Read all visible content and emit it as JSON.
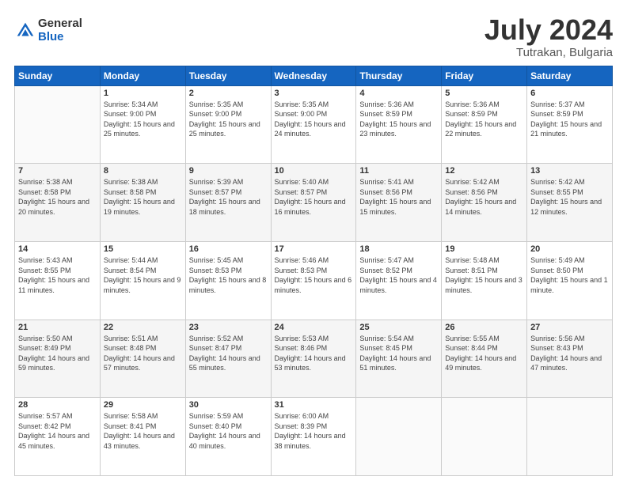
{
  "logo": {
    "general": "General",
    "blue": "Blue"
  },
  "header": {
    "month_year": "July 2024",
    "location": "Tutrakan, Bulgaria"
  },
  "weekdays": [
    "Sunday",
    "Monday",
    "Tuesday",
    "Wednesday",
    "Thursday",
    "Friday",
    "Saturday"
  ],
  "weeks": [
    [
      {
        "day": "",
        "sunrise": "",
        "sunset": "",
        "daylight": ""
      },
      {
        "day": "1",
        "sunrise": "Sunrise: 5:34 AM",
        "sunset": "Sunset: 9:00 PM",
        "daylight": "Daylight: 15 hours and 25 minutes."
      },
      {
        "day": "2",
        "sunrise": "Sunrise: 5:35 AM",
        "sunset": "Sunset: 9:00 PM",
        "daylight": "Daylight: 15 hours and 25 minutes."
      },
      {
        "day": "3",
        "sunrise": "Sunrise: 5:35 AM",
        "sunset": "Sunset: 9:00 PM",
        "daylight": "Daylight: 15 hours and 24 minutes."
      },
      {
        "day": "4",
        "sunrise": "Sunrise: 5:36 AM",
        "sunset": "Sunset: 8:59 PM",
        "daylight": "Daylight: 15 hours and 23 minutes."
      },
      {
        "day": "5",
        "sunrise": "Sunrise: 5:36 AM",
        "sunset": "Sunset: 8:59 PM",
        "daylight": "Daylight: 15 hours and 22 minutes."
      },
      {
        "day": "6",
        "sunrise": "Sunrise: 5:37 AM",
        "sunset": "Sunset: 8:59 PM",
        "daylight": "Daylight: 15 hours and 21 minutes."
      }
    ],
    [
      {
        "day": "7",
        "sunrise": "Sunrise: 5:38 AM",
        "sunset": "Sunset: 8:58 PM",
        "daylight": "Daylight: 15 hours and 20 minutes."
      },
      {
        "day": "8",
        "sunrise": "Sunrise: 5:38 AM",
        "sunset": "Sunset: 8:58 PM",
        "daylight": "Daylight: 15 hours and 19 minutes."
      },
      {
        "day": "9",
        "sunrise": "Sunrise: 5:39 AM",
        "sunset": "Sunset: 8:57 PM",
        "daylight": "Daylight: 15 hours and 18 minutes."
      },
      {
        "day": "10",
        "sunrise": "Sunrise: 5:40 AM",
        "sunset": "Sunset: 8:57 PM",
        "daylight": "Daylight: 15 hours and 16 minutes."
      },
      {
        "day": "11",
        "sunrise": "Sunrise: 5:41 AM",
        "sunset": "Sunset: 8:56 PM",
        "daylight": "Daylight: 15 hours and 15 minutes."
      },
      {
        "day": "12",
        "sunrise": "Sunrise: 5:42 AM",
        "sunset": "Sunset: 8:56 PM",
        "daylight": "Daylight: 15 hours and 14 minutes."
      },
      {
        "day": "13",
        "sunrise": "Sunrise: 5:42 AM",
        "sunset": "Sunset: 8:55 PM",
        "daylight": "Daylight: 15 hours and 12 minutes."
      }
    ],
    [
      {
        "day": "14",
        "sunrise": "Sunrise: 5:43 AM",
        "sunset": "Sunset: 8:55 PM",
        "daylight": "Daylight: 15 hours and 11 minutes."
      },
      {
        "day": "15",
        "sunrise": "Sunrise: 5:44 AM",
        "sunset": "Sunset: 8:54 PM",
        "daylight": "Daylight: 15 hours and 9 minutes."
      },
      {
        "day": "16",
        "sunrise": "Sunrise: 5:45 AM",
        "sunset": "Sunset: 8:53 PM",
        "daylight": "Daylight: 15 hours and 8 minutes."
      },
      {
        "day": "17",
        "sunrise": "Sunrise: 5:46 AM",
        "sunset": "Sunset: 8:53 PM",
        "daylight": "Daylight: 15 hours and 6 minutes."
      },
      {
        "day": "18",
        "sunrise": "Sunrise: 5:47 AM",
        "sunset": "Sunset: 8:52 PM",
        "daylight": "Daylight: 15 hours and 4 minutes."
      },
      {
        "day": "19",
        "sunrise": "Sunrise: 5:48 AM",
        "sunset": "Sunset: 8:51 PM",
        "daylight": "Daylight: 15 hours and 3 minutes."
      },
      {
        "day": "20",
        "sunrise": "Sunrise: 5:49 AM",
        "sunset": "Sunset: 8:50 PM",
        "daylight": "Daylight: 15 hours and 1 minute."
      }
    ],
    [
      {
        "day": "21",
        "sunrise": "Sunrise: 5:50 AM",
        "sunset": "Sunset: 8:49 PM",
        "daylight": "Daylight: 14 hours and 59 minutes."
      },
      {
        "day": "22",
        "sunrise": "Sunrise: 5:51 AM",
        "sunset": "Sunset: 8:48 PM",
        "daylight": "Daylight: 14 hours and 57 minutes."
      },
      {
        "day": "23",
        "sunrise": "Sunrise: 5:52 AM",
        "sunset": "Sunset: 8:47 PM",
        "daylight": "Daylight: 14 hours and 55 minutes."
      },
      {
        "day": "24",
        "sunrise": "Sunrise: 5:53 AM",
        "sunset": "Sunset: 8:46 PM",
        "daylight": "Daylight: 14 hours and 53 minutes."
      },
      {
        "day": "25",
        "sunrise": "Sunrise: 5:54 AM",
        "sunset": "Sunset: 8:45 PM",
        "daylight": "Daylight: 14 hours and 51 minutes."
      },
      {
        "day": "26",
        "sunrise": "Sunrise: 5:55 AM",
        "sunset": "Sunset: 8:44 PM",
        "daylight": "Daylight: 14 hours and 49 minutes."
      },
      {
        "day": "27",
        "sunrise": "Sunrise: 5:56 AM",
        "sunset": "Sunset: 8:43 PM",
        "daylight": "Daylight: 14 hours and 47 minutes."
      }
    ],
    [
      {
        "day": "28",
        "sunrise": "Sunrise: 5:57 AM",
        "sunset": "Sunset: 8:42 PM",
        "daylight": "Daylight: 14 hours and 45 minutes."
      },
      {
        "day": "29",
        "sunrise": "Sunrise: 5:58 AM",
        "sunset": "Sunset: 8:41 PM",
        "daylight": "Daylight: 14 hours and 43 minutes."
      },
      {
        "day": "30",
        "sunrise": "Sunrise: 5:59 AM",
        "sunset": "Sunset: 8:40 PM",
        "daylight": "Daylight: 14 hours and 40 minutes."
      },
      {
        "day": "31",
        "sunrise": "Sunrise: 6:00 AM",
        "sunset": "Sunset: 8:39 PM",
        "daylight": "Daylight: 14 hours and 38 minutes."
      },
      {
        "day": "",
        "sunrise": "",
        "sunset": "",
        "daylight": ""
      },
      {
        "day": "",
        "sunrise": "",
        "sunset": "",
        "daylight": ""
      },
      {
        "day": "",
        "sunrise": "",
        "sunset": "",
        "daylight": ""
      }
    ]
  ]
}
